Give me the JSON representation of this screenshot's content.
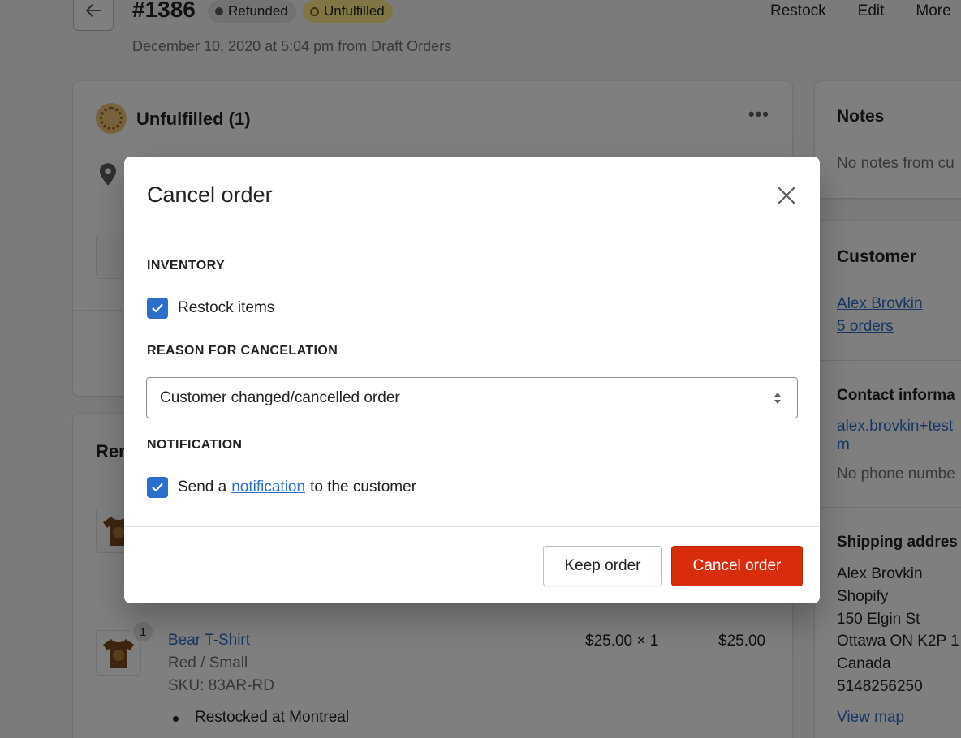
{
  "header": {
    "order_number": "#1386",
    "badges": {
      "refunded": "Refunded",
      "unfulfilled": "Unfulfilled"
    },
    "actions": {
      "restock": "Restock",
      "edit": "Edit",
      "more": "More"
    },
    "date": "December 10, 2020 at 5:04 pm from Draft Orders"
  },
  "unfulfilled_card": {
    "title": "Unfulfilled (1)",
    "menu": "•••"
  },
  "removed_card": {
    "title": "Rem",
    "item": {
      "quantity": "1",
      "name": "Bear T-Shirt",
      "variant": "Red / Small",
      "sku": "SKU: 83AR-RD",
      "price": "$25.00 × 1",
      "total": "$25.00",
      "status": "Restocked at Montreal"
    }
  },
  "sidebar": {
    "notes": {
      "title": "Notes",
      "text": "No notes from cu"
    },
    "customer": {
      "title": "Customer",
      "name": "Alex Brovkin",
      "orders": "5 orders",
      "contact_title": "Contact informa",
      "email_line1": "alex.brovkin+test",
      "email_line2": "m",
      "phone": "No phone numbe",
      "shipping_title": "Shipping addres",
      "address": [
        "Alex Brovkin",
        "Shopify",
        "150 Elgin St",
        "Ottawa ON K2P 1",
        "Canada",
        "5148256250"
      ],
      "view_map": "View map"
    }
  },
  "modal": {
    "title": "Cancel order",
    "inventory_label": "INVENTORY",
    "restock_label": "Restock items",
    "restock_checked": true,
    "reason_label": "REASON FOR CANCELATION",
    "reason_value": "Customer changed/cancelled order",
    "notification_label": "NOTIFICATION",
    "notify_prefix": "Send a",
    "notify_link": "notification",
    "notify_suffix": "to the customer",
    "notify_checked": true,
    "keep_button": "Keep order",
    "cancel_button": "Cancel order"
  },
  "colors": {
    "primary_blue": "#2c6ecb",
    "danger_red": "#d82c0d",
    "unfulfilled_yellow": "#ffea8a",
    "refunded_gray": "#e4e5e7"
  }
}
